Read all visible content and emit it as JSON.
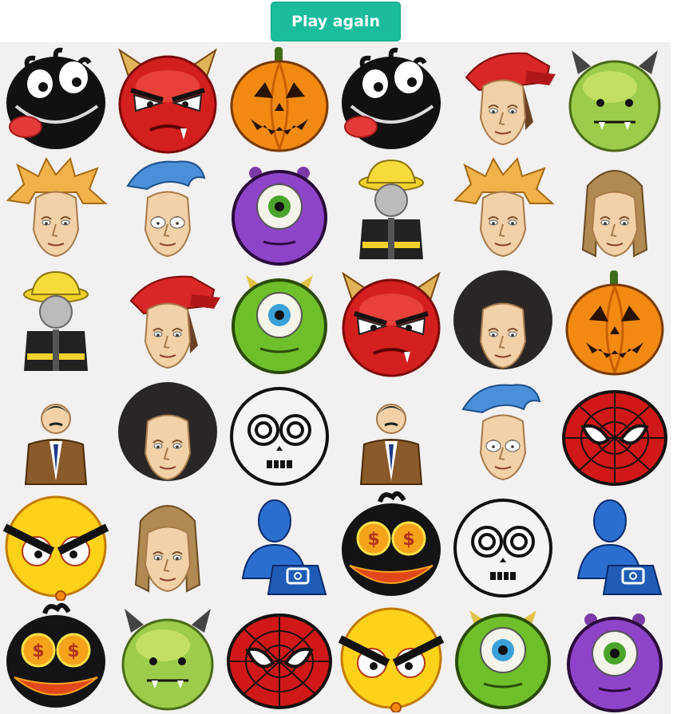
{
  "header": {
    "play_again_label": "Play again"
  },
  "board": {
    "rows": 6,
    "cols": 6,
    "tiles": [
      "black-tongue-face-icon",
      "red-devil-face-icon",
      "jack-o-lantern-icon",
      "black-tongue-face-icon",
      "red-cap-guy-icon",
      "green-horned-monster-icon",
      "spiky-blond-boy-icon",
      "blue-hair-guy-icon",
      "purple-cyclops-icon",
      "firefighter-icon",
      "spiky-blond-boy-icon",
      "long-hair-man-icon",
      "firefighter-icon",
      "red-cap-guy-icon",
      "green-cyclops-icon",
      "red-devil-face-icon",
      "afro-guy-icon",
      "jack-o-lantern-icon",
      "businessman-icon",
      "afro-guy-icon",
      "skull-face-icon",
      "businessman-icon",
      "blue-hair-guy-icon",
      "spider-mask-icon",
      "angry-yellow-face-icon",
      "long-hair-man-icon",
      "blue-user-phone-icon",
      "money-eyes-face-icon",
      "skull-face-icon",
      "blue-user-phone-icon",
      "money-eyes-face-icon",
      "green-horned-monster-icon",
      "spider-mask-icon",
      "angry-yellow-face-icon",
      "green-cyclops-icon",
      "purple-cyclops-icon"
    ]
  }
}
